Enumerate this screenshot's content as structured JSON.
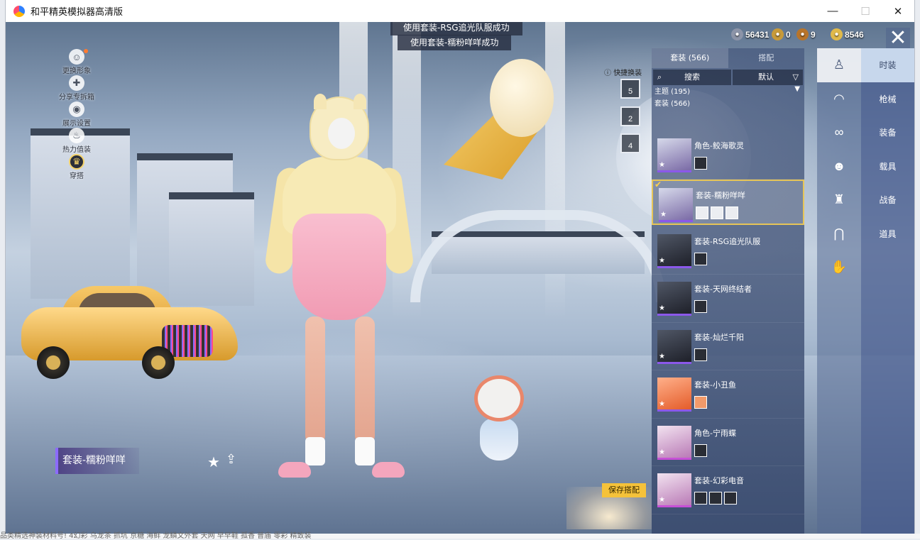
{
  "window": {
    "title": "和平精英模拟器高清版",
    "controls": {
      "minimize": "—",
      "maximize": "☐",
      "close": "✕"
    }
  },
  "notifications": [
    "使用套装-RSG追光队服成功",
    "使用套装-糯粉咩咩成功"
  ],
  "side_menu": [
    {
      "label": "更换形象",
      "icon": "person-icon",
      "glyph": "☺",
      "has_dot": true
    },
    {
      "label": "分享专拆箱",
      "icon": "share-gear-icon",
      "glyph": "✚",
      "has_dot": false
    },
    {
      "label": "展示设置",
      "icon": "eye-icon",
      "glyph": "◉",
      "has_dot": false
    },
    {
      "label": "热力值装",
      "icon": "flame-icon",
      "glyph": "♨",
      "has_dot": false
    },
    {
      "label": "穿搭",
      "icon": "badge-icon",
      "glyph": "♛",
      "has_dot": false
    }
  ],
  "currencies": [
    {
      "name": "silver-coin",
      "value": "56431",
      "color": "#8c94a8"
    },
    {
      "name": "gold-token",
      "value": "0",
      "color": "#c79a3a"
    },
    {
      "name": "bronze-token",
      "value": "9",
      "color": "#b8742a"
    },
    {
      "name": "uc-coin",
      "value": "8546",
      "color": "#e0b94a"
    }
  ],
  "presets": {
    "hint": "快捷换装",
    "buttons": [
      "5",
      "2",
      "4"
    ]
  },
  "panel": {
    "tabs": [
      "套装 (566)",
      "搭配"
    ],
    "search_label": "搜索",
    "sort_label": "默认",
    "filters": [
      "主题 (195)",
      "套装 (566)"
    ],
    "items": [
      {
        "name": "角色-鲛海歌灵",
        "thumb": "light",
        "subthumbs": [
          "dark"
        ],
        "selected": false
      },
      {
        "name": "套装-糯粉咩咩",
        "thumb": "light",
        "subthumbs": [
          "light",
          "light",
          "light"
        ],
        "selected": true
      },
      {
        "name": "套装-RSG追光队服",
        "thumb": "dark",
        "subthumbs": [
          "dark"
        ],
        "selected": false
      },
      {
        "name": "套装-天网终结者",
        "thumb": "dark",
        "subthumbs": [
          "dark"
        ],
        "selected": false
      },
      {
        "name": "套装-灿烂千阳",
        "thumb": "dark",
        "subthumbs": [
          "dark"
        ],
        "selected": false
      },
      {
        "name": "套装-小丑鱼",
        "thumb": "orange",
        "subthumbs": [
          "light"
        ],
        "selected": false
      },
      {
        "name": "角色-宁雨蝶",
        "thumb": "pink",
        "subthumbs": [
          "dark"
        ],
        "selected": false
      },
      {
        "name": "套装-幻彩电音",
        "thumb": "pink",
        "subthumbs": [
          "dark",
          "dark",
          "dark"
        ],
        "selected": false
      }
    ]
  },
  "category_icons": [
    {
      "name": "outfit-icon",
      "glyph": "♙",
      "active": true
    },
    {
      "name": "hat-icon",
      "glyph": "◠",
      "active": false
    },
    {
      "name": "glasses-icon",
      "glyph": "∞",
      "active": false
    },
    {
      "name": "face-icon",
      "glyph": "☻",
      "active": false
    },
    {
      "name": "top-icon",
      "glyph": "♜",
      "active": false
    },
    {
      "name": "pants-icon",
      "glyph": "⋂",
      "active": false
    },
    {
      "name": "gloves-icon",
      "glyph": "✋",
      "active": false
    }
  ],
  "categories": [
    "时装",
    "枪械",
    "装备",
    "载具",
    "战备",
    "道具"
  ],
  "active_category": "时装",
  "outfit_label": "套装-糯粉咩咩",
  "save_button": "保存搭配",
  "check_mark": "✔",
  "star": "★",
  "close_glyph": "✕",
  "share_glyph": "⇪",
  "search_glyph": "⌕",
  "sort_glyph": "▽",
  "filter_glyph": "▼",
  "under_text": "品类精选神装材料号! 4幻彩 乌龙茶 抓坑 京糖 海鲜 龙鳞文外套 天网 早早鞋 孤香 普庙 零彩 精致装"
}
